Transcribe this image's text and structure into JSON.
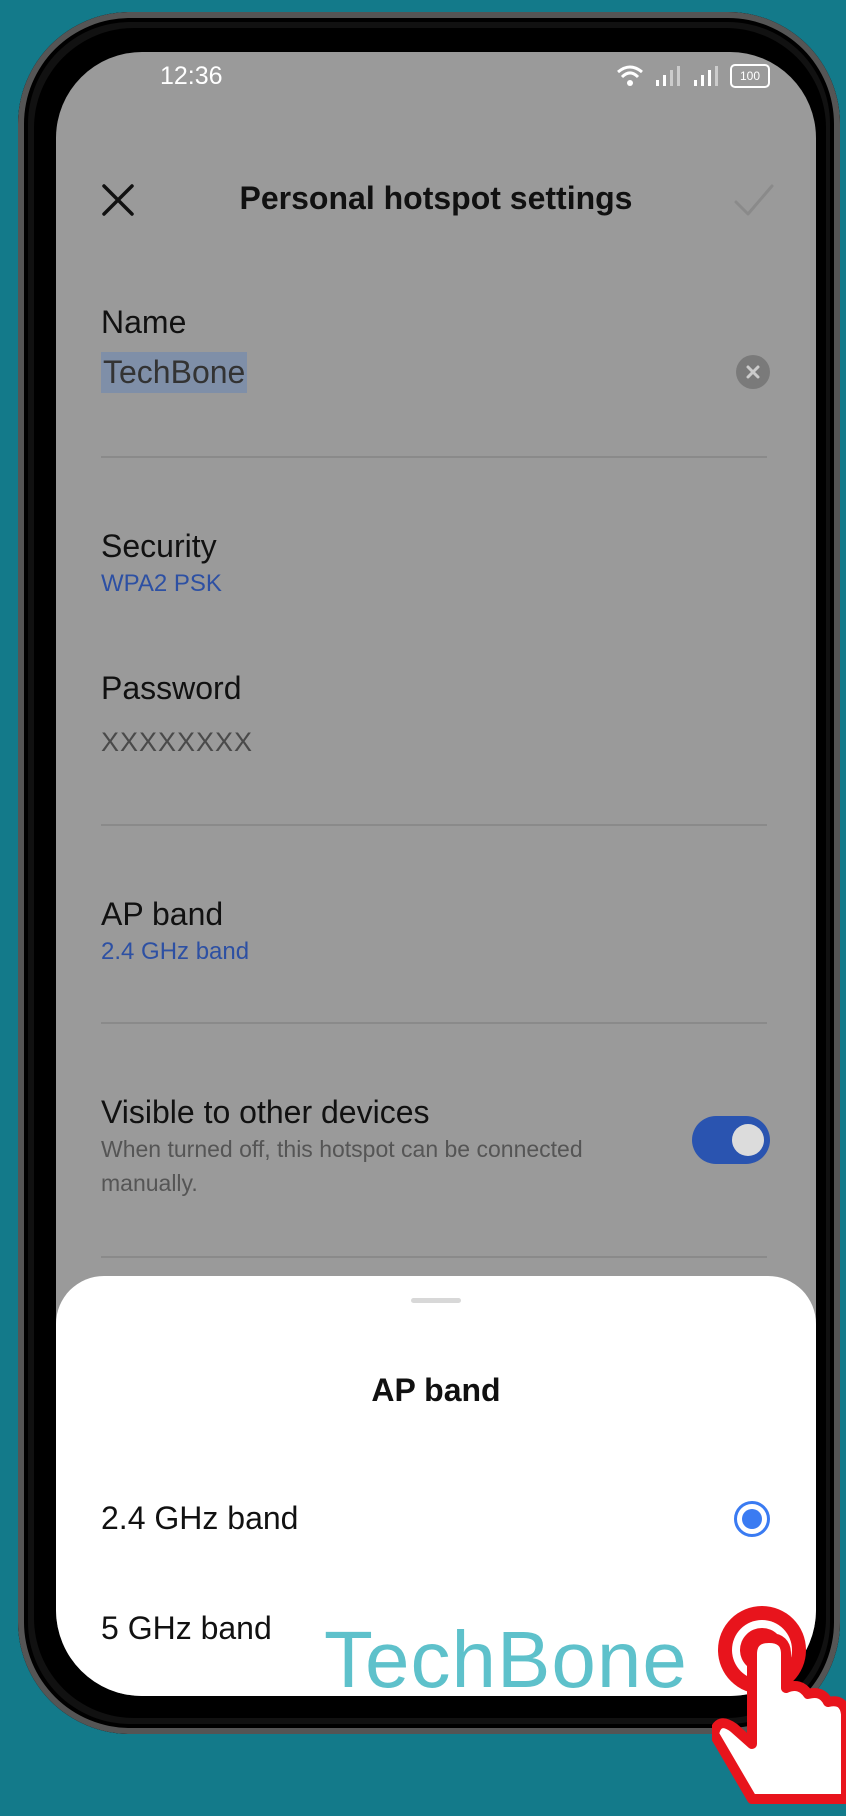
{
  "status": {
    "time": "12:36",
    "battery": "100"
  },
  "toolbar": {
    "title": "Personal hotspot settings"
  },
  "name": {
    "label": "Name",
    "value": "TechBone"
  },
  "security": {
    "label": "Security",
    "value": "WPA2 PSK"
  },
  "password": {
    "label": "Password",
    "value": "XXXXXXXX"
  },
  "ap_band": {
    "label": "AP band",
    "value": "2.4 GHz band"
  },
  "visible": {
    "label": "Visible to other devices",
    "description": "When turned off, this hotspot can be connected manually.",
    "enabled": true
  },
  "sheet": {
    "title": "AP band",
    "options": [
      {
        "label": "2.4 GHz band",
        "selected": true
      },
      {
        "label": "5 GHz band",
        "selected": false
      }
    ]
  },
  "watermark": "TechBone",
  "colors": {
    "background": "#137a8a",
    "accent": "#3a7bf2",
    "link": "#2d50a3",
    "hand": "#e8141c"
  }
}
